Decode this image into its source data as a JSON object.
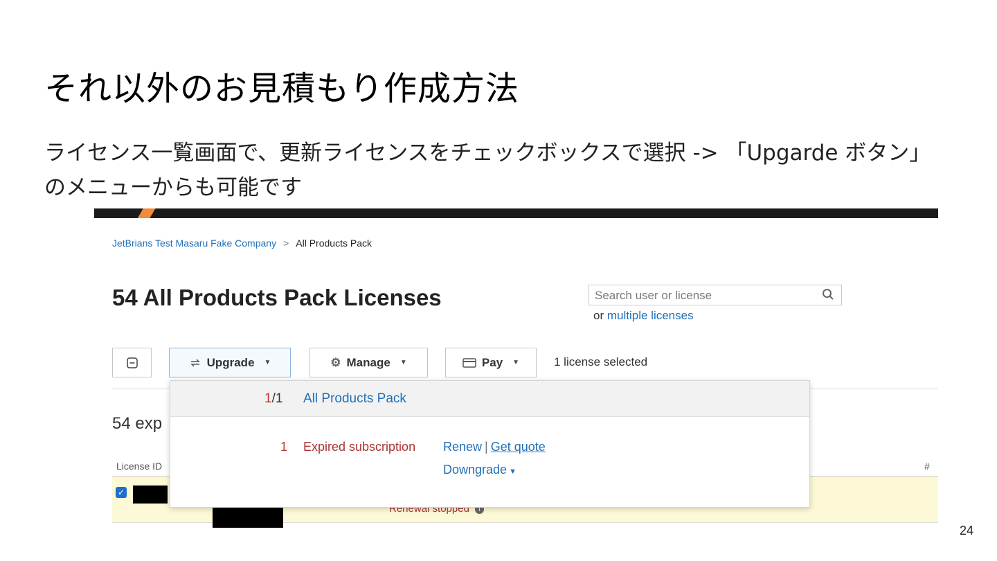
{
  "slide": {
    "title": "それ以外のお見積もり作成方法",
    "body_line1": "ライセンス一覧画面で、更新ライセンスをチェックボックスで選択 -> 「Upgarde ボタン」",
    "body_line2": "のメニューからも可能です",
    "page_number": "24"
  },
  "app": {
    "colors": {
      "topbar": "#1b1b1b",
      "accent_orange": "#f08a3c",
      "link": "#1f6fb7",
      "row_highlight": "#fdf8d6"
    },
    "breadcrumb": {
      "company": "JetBrians Test Masaru Fake Company",
      "separator": ">",
      "current": "All Products Pack"
    },
    "heading": "54 All Products Pack Licenses",
    "search": {
      "placeholder": "Search user or license",
      "icon": "search-icon"
    },
    "or_text": "or",
    "multiple_link": "multiple licenses",
    "toolbar": {
      "upgrade_label": "Upgrade",
      "manage_label": "Manage",
      "pay_label": "Pay",
      "selected_text": "1 license selected"
    },
    "section_title": "54 exp",
    "table": {
      "col_license_id": "License ID",
      "col_hash": "#"
    },
    "row": {
      "renewal_status": "Renewal stopped"
    },
    "dropdown": {
      "selected_num": "1",
      "fraction_rest": "/1",
      "product": "All Products Pack",
      "count": "1",
      "status": "Expired subscription",
      "renew": "Renew",
      "action_sep": "|",
      "get_quote": "Get quote",
      "downgrade": "Downgrade"
    }
  }
}
